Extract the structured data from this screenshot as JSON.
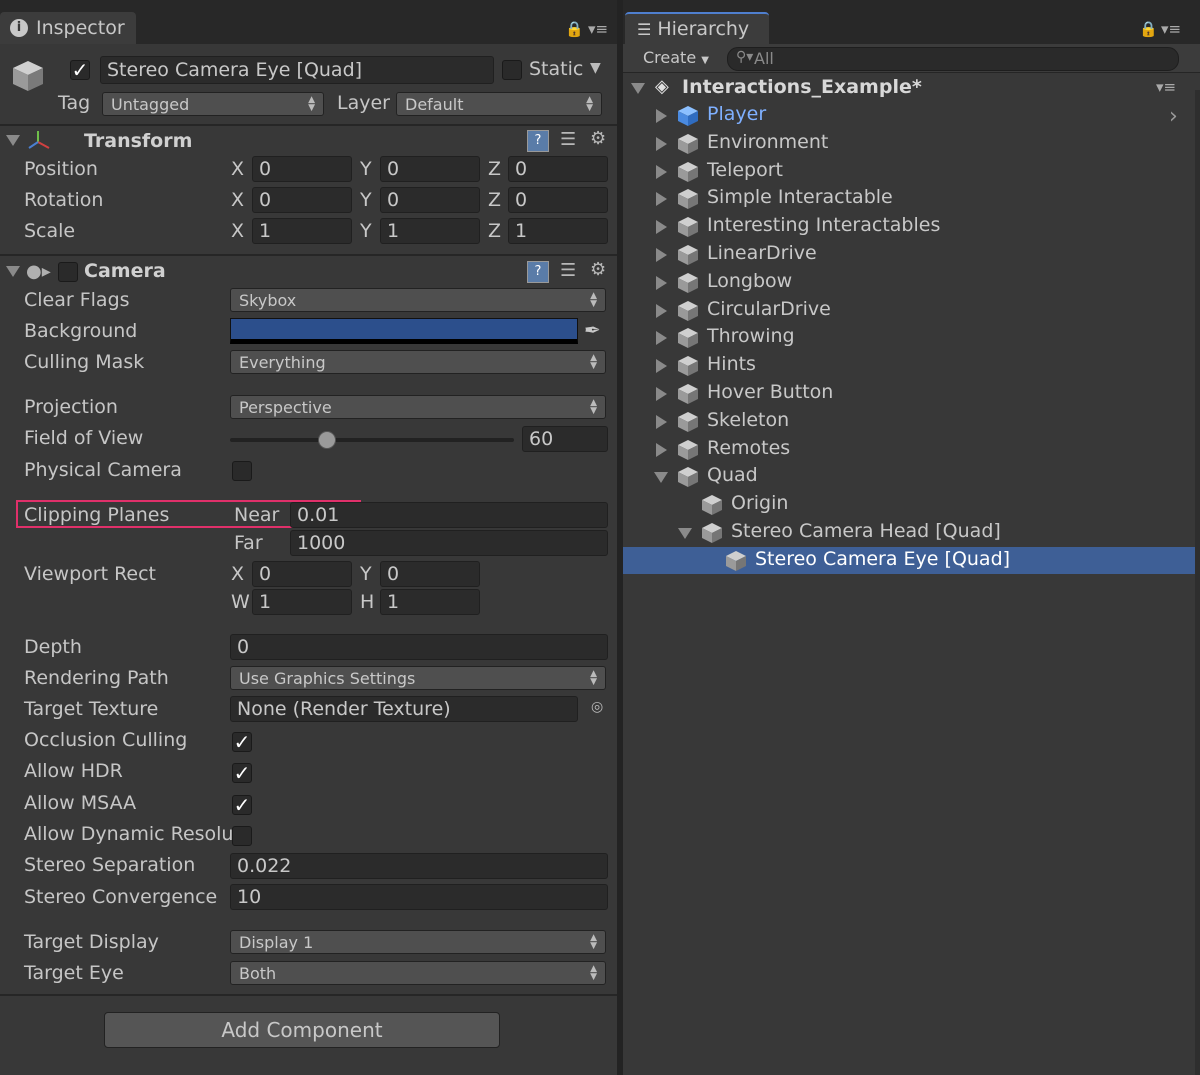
{
  "inspector": {
    "tab_label": "Inspector",
    "object_name": "Stereo Camera Eye [Quad]",
    "static_label": "Static",
    "tag_label": "Tag",
    "tag_value": "Untagged",
    "layer_label": "Layer",
    "layer_value": "Default",
    "transform": {
      "title": "Transform",
      "rows": [
        {
          "label": "Position",
          "x": "0",
          "y": "0",
          "z": "0"
        },
        {
          "label": "Rotation",
          "x": "0",
          "y": "0",
          "z": "0"
        },
        {
          "label": "Scale",
          "x": "1",
          "y": "1",
          "z": "1"
        }
      ],
      "x_label": "X",
      "y_label": "Y",
      "z_label": "Z"
    },
    "camera": {
      "title": "Camera",
      "clear_flags_label": "Clear Flags",
      "clear_flags_value": "Skybox",
      "background_label": "Background",
      "background_color": "#2c4f8c",
      "culling_mask_label": "Culling Mask",
      "culling_mask_value": "Everything",
      "projection_label": "Projection",
      "projection_value": "Perspective",
      "fov_label": "Field of View",
      "fov_value": "60",
      "fov_slider_fraction": 0.34,
      "physical_camera_label": "Physical Camera",
      "clipping_label": "Clipping Planes",
      "near_label": "Near",
      "near_value": "0.01",
      "far_label": "Far",
      "far_value": "1000",
      "viewport_label": "Viewport Rect",
      "vp_x_label": "X",
      "vp_x": "0",
      "vp_y_label": "Y",
      "vp_y": "0",
      "vp_w_label": "W",
      "vp_w": "1",
      "vp_h_label": "H",
      "vp_h": "1",
      "depth_label": "Depth",
      "depth_value": "0",
      "rendering_path_label": "Rendering Path",
      "rendering_path_value": "Use Graphics Settings",
      "target_texture_label": "Target Texture",
      "target_texture_value": "None (Render Texture)",
      "occlusion_label": "Occlusion Culling",
      "hdr_label": "Allow HDR",
      "msaa_label": "Allow MSAA",
      "dynamic_res_label": "Allow Dynamic Resolu",
      "stereo_sep_label": "Stereo Separation",
      "stereo_sep_value": "0.022",
      "stereo_conv_label": "Stereo Convergence",
      "stereo_conv_value": "10",
      "target_display_label": "Target Display",
      "target_display_value": "Display 1",
      "target_eye_label": "Target Eye",
      "target_eye_value": "Both"
    },
    "add_component_label": "Add Component",
    "highlight_color": "#e0306a"
  },
  "hierarchy": {
    "tab_label": "Hierarchy",
    "create_label": "Create",
    "search_placeholder": "All",
    "scene_name": "Interactions_Example*",
    "selected_color": "#3e5f96",
    "items": [
      {
        "label": "Player"
      },
      {
        "label": "Environment"
      },
      {
        "label": "Teleport"
      },
      {
        "label": "Simple Interactable"
      },
      {
        "label": "Interesting Interactables"
      },
      {
        "label": "LinearDrive"
      },
      {
        "label": "Longbow"
      },
      {
        "label": "CircularDrive"
      },
      {
        "label": "Throwing"
      },
      {
        "label": "Hints"
      },
      {
        "label": "Hover Button"
      },
      {
        "label": "Skeleton"
      },
      {
        "label": "Remotes"
      },
      {
        "label": "Quad"
      },
      {
        "label": "Origin"
      },
      {
        "label": "Stereo Camera Head [Quad]"
      },
      {
        "label": "Stereo Camera Eye [Quad]"
      }
    ]
  }
}
